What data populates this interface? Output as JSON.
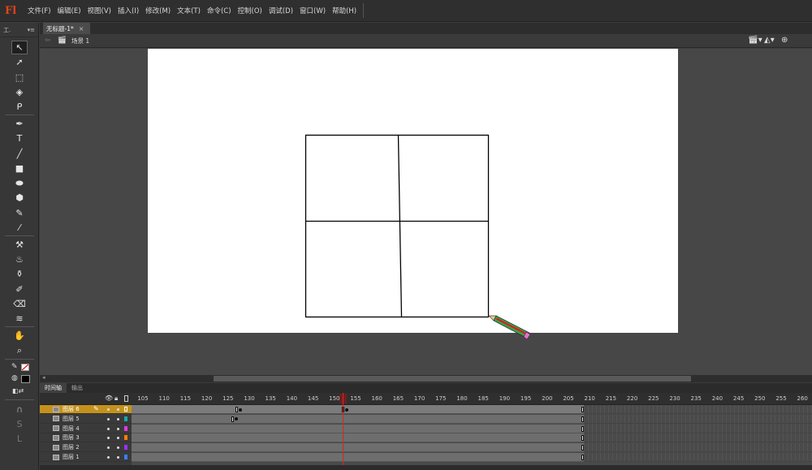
{
  "app": {
    "logo": "Fl"
  },
  "menu": [
    "文件(F)",
    "编辑(E)",
    "视图(V)",
    "插入(I)",
    "修改(M)",
    "文本(T)",
    "命令(C)",
    "控制(O)",
    "调试(D)",
    "窗口(W)",
    "帮助(H)"
  ],
  "tools_panel": {
    "title": "工.",
    "collapse": "◂◂",
    "menu": "▾≡"
  },
  "document": {
    "tab_label": "无标题-1*",
    "close": "×"
  },
  "scene": {
    "label": "场景 1"
  },
  "timeline": {
    "tabs": [
      "时间轴",
      "输出"
    ],
    "ruler": [
      "105",
      "110",
      "115",
      "120",
      "125",
      "130",
      "135",
      "140",
      "145",
      "150",
      "155",
      "160",
      "165",
      "170",
      "175",
      "180",
      "185",
      "190",
      "195",
      "200",
      "205",
      "210",
      "215",
      "220",
      "225",
      "230",
      "235",
      "240",
      "245",
      "250",
      "255",
      "260"
    ],
    "layers": [
      {
        "name": "图层 6",
        "color": "#d4a017",
        "selected": true
      },
      {
        "name": "图层 5",
        "color": "#1fa6a6",
        "selected": false
      },
      {
        "name": "图层 4",
        "color": "#e23be2",
        "selected": false
      },
      {
        "name": "图层 3",
        "color": "#ff7f00",
        "selected": false
      },
      {
        "name": "图层 2",
        "color": "#9b30ff",
        "selected": false
      },
      {
        "name": "图层 1",
        "color": "#3c7dff",
        "selected": false
      }
    ],
    "playhead_frame": 154
  },
  "colors": {
    "accent": "#c4921c",
    "stage": "#ffffff",
    "playhead": "#dd2222"
  }
}
